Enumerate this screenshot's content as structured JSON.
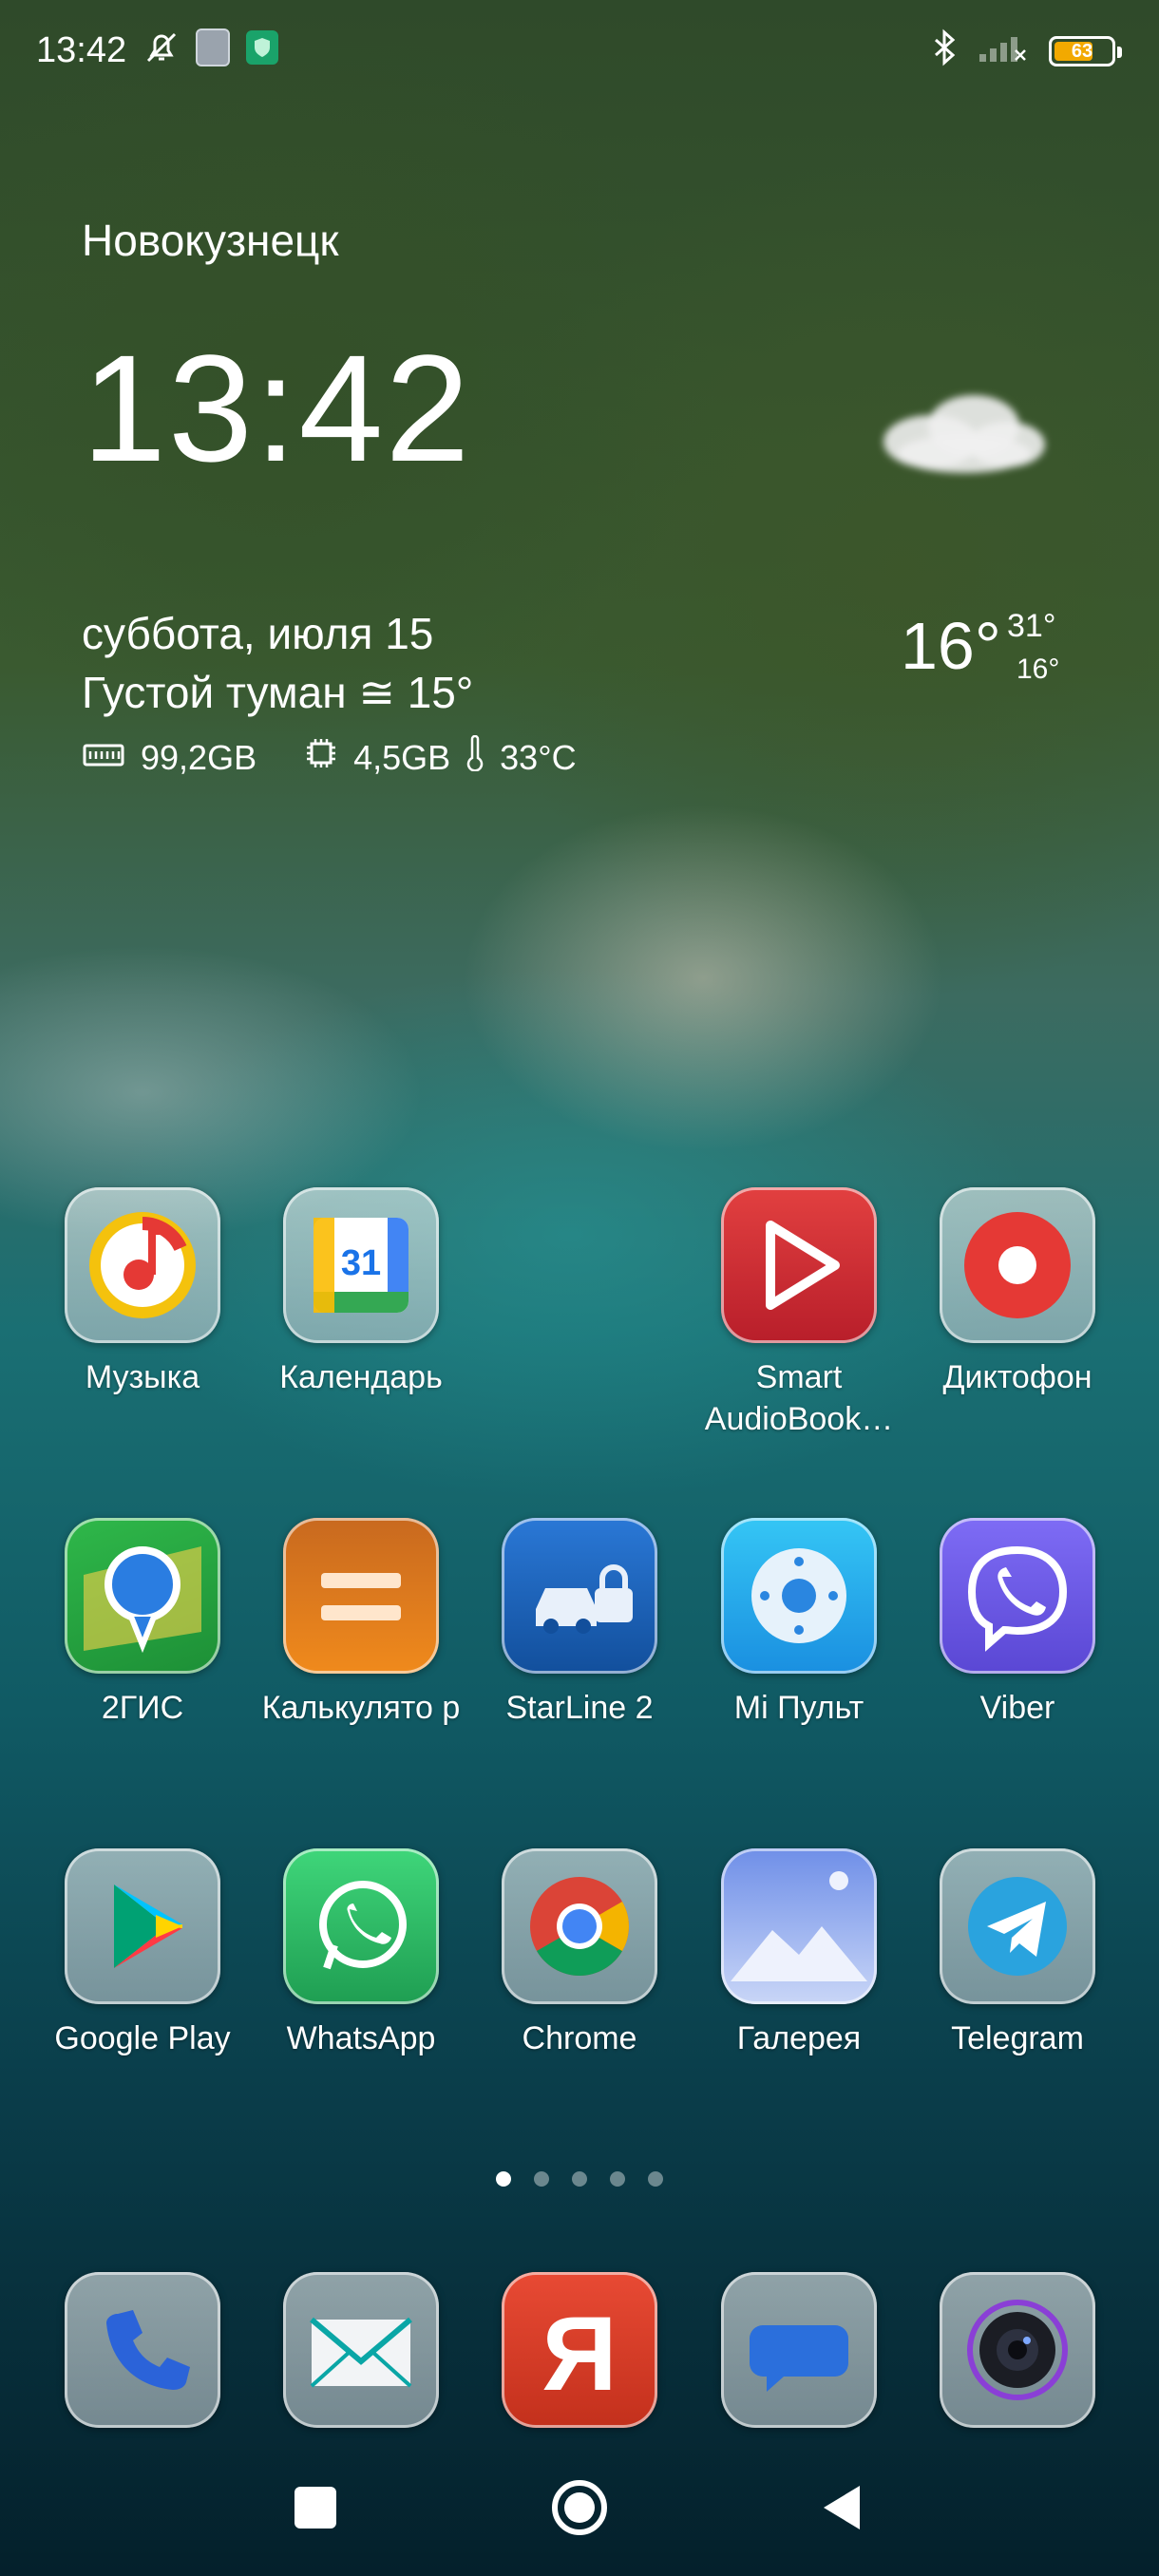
{
  "status_bar": {
    "time": "13:42",
    "battery": "63",
    "icons": [
      "bell-off-icon",
      "sim-icon",
      "shield-icon",
      "bluetooth-icon",
      "signal-icon",
      "battery-icon"
    ]
  },
  "widget": {
    "city": "Новокузнецк",
    "clock": "13:42",
    "date": "суббота, июля 15",
    "condition": "Густой туман",
    "condition_temp": "15°",
    "storage": "99,2GB",
    "ram": "4,5GB",
    "cpu_temp": "33°C",
    "temp_now": "16°",
    "temp_high": "31°",
    "temp_low": "16°"
  },
  "apps": {
    "row1": [
      {
        "label": "Музыка",
        "icon": "music-icon"
      },
      {
        "label": "Календарь",
        "icon": "calendar-icon",
        "day": "31"
      },
      {
        "label": "Smart AudioBook…",
        "icon": "audiobook-icon"
      },
      {
        "label": "Диктофон",
        "icon": "recorder-icon"
      }
    ],
    "row2": [
      {
        "label": "2ГИС",
        "icon": "2gis-icon"
      },
      {
        "label": "Калькулято р",
        "icon": "calculator-icon"
      },
      {
        "label": "StarLine 2",
        "icon": "starline-icon"
      },
      {
        "label": "Mi Пульт",
        "icon": "remote-icon"
      },
      {
        "label": "Viber",
        "icon": "viber-icon"
      }
    ],
    "row3": [
      {
        "label": "Google Play",
        "icon": "play-store-icon"
      },
      {
        "label": "WhatsApp",
        "icon": "whatsapp-icon"
      },
      {
        "label": "Chrome",
        "icon": "chrome-icon"
      },
      {
        "label": "Галерея",
        "icon": "gallery-icon"
      },
      {
        "label": "Telegram",
        "icon": "telegram-icon"
      }
    ],
    "dock": [
      {
        "icon": "phone-icon"
      },
      {
        "icon": "mail-icon"
      },
      {
        "icon": "yandex-icon",
        "letter": "Я"
      },
      {
        "icon": "messages-icon"
      },
      {
        "icon": "camera-icon"
      }
    ]
  },
  "pager": {
    "pages": 5,
    "active": 0
  },
  "navigation": [
    "recents-button",
    "home-button",
    "back-button"
  ],
  "colors": {
    "battery": "#f2a900",
    "viber": "#7360f2",
    "whatsapp": "#25d366",
    "telegram": "#2aa3de"
  }
}
